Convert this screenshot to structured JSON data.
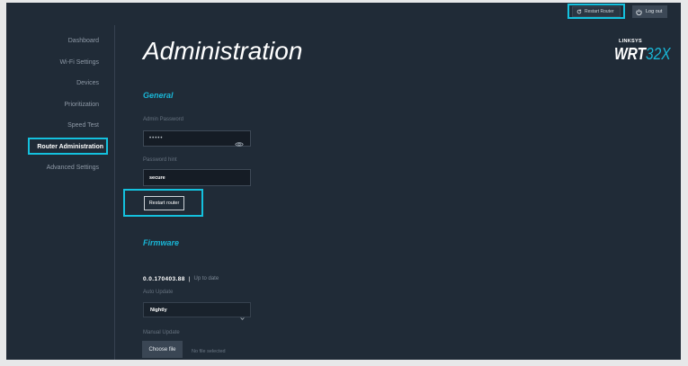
{
  "topbar": {
    "restart_router_label": "Restart Router",
    "logout_label": "Log out",
    "restart_icon": "restart-icon",
    "logout_icon": "power-icon"
  },
  "brand": {
    "vendor": "LINKSYS",
    "model_prefix": "WRT",
    "model_suffix": "32X"
  },
  "sidebar": {
    "items": [
      {
        "label": "Dashboard",
        "active": false
      },
      {
        "label": "Wi-Fi Settings",
        "active": false
      },
      {
        "label": "Devices",
        "active": false
      },
      {
        "label": "Prioritization",
        "active": false
      },
      {
        "label": "Speed Test",
        "active": false
      },
      {
        "label": "Router Administration",
        "active": true
      },
      {
        "label": "Advanced Settings",
        "active": false
      }
    ]
  },
  "page": {
    "title": "Administration"
  },
  "general": {
    "heading": "General",
    "admin_password_label": "Admin Password",
    "admin_password_value": "•••••",
    "show_password_icon": "eye-icon",
    "password_hint_label": "Password hint",
    "password_hint_value": "secure",
    "restart_router_button_label": "Restart router"
  },
  "firmware": {
    "heading": "Firmware",
    "version": "0.0.170403.88",
    "separator": "|",
    "status": "Up to date",
    "auto_update_label": "Auto Update",
    "auto_update_selected": "Nightly",
    "dropdown_icon": "chevron-down-icon",
    "manual_update_label": "Manual Update",
    "choose_file_label": "Choose file",
    "no_file_selected_text": "No file selected"
  },
  "colors": {
    "background": "#202b37",
    "accent": "#19b6d6",
    "highlight_annotation": "#14c1de",
    "text_primary": "#ffffff",
    "text_muted": "#8e99a6",
    "input_background": "#151c25"
  }
}
